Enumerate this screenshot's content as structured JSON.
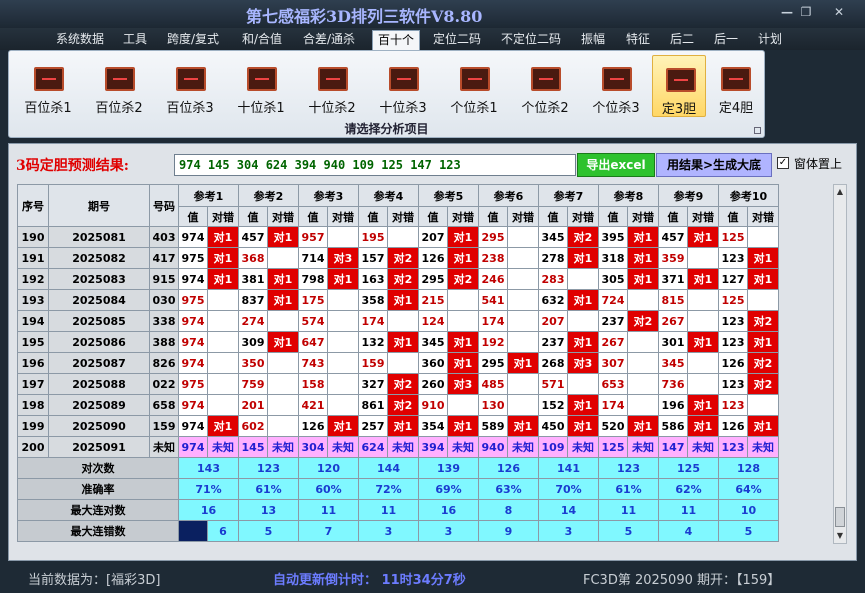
{
  "window": {
    "title": "第七感福彩3D排列三软件V8.80",
    "btn_min": "—",
    "btn_restore": "❐",
    "btn_close": "✕"
  },
  "menu": [
    "系统数据",
    "工具",
    "跨度/复式",
    "和/合值",
    "合差/通杀",
    "百十个",
    "定位二码",
    "不定位二码",
    "振幅",
    "特征",
    "后二",
    "后一",
    "计划"
  ],
  "menu_active": 5,
  "ribbon": {
    "buttons": [
      "百位杀1",
      "百位杀2",
      "百位杀3",
      "十位杀1",
      "十位杀2",
      "十位杀3",
      "个位杀1",
      "个位杀2",
      "个位杀3",
      "定3胆",
      "定4胆"
    ],
    "selected": 9,
    "label": "请选择分析项目"
  },
  "result": {
    "label": "3码定胆预测结果:",
    "value": "974 145 304 624 394 940 109 125 147 123",
    "export_label": "导出excel",
    "apply_label": "用结果>生成大底",
    "ontop_label": "窗体置上",
    "ontop_checked": "✓"
  },
  "table": {
    "headers": {
      "seq": "序号",
      "period": "期号",
      "num": "号码",
      "refs": [
        "参考1",
        "参考2",
        "参考3",
        "参考4",
        "参考5",
        "参考6",
        "参考7",
        "参考8",
        "参考9",
        "参考10"
      ],
      "val": "值",
      "ok": "对错"
    },
    "rows": [
      {
        "seq": "190",
        "period": "2025081",
        "num": "403",
        "cells": [
          [
            "974",
            "对1"
          ],
          [
            "457",
            "对1"
          ],
          [
            "957",
            ""
          ],
          [
            "195",
            ""
          ],
          [
            "207",
            "对1"
          ],
          [
            "295",
            ""
          ],
          [
            "345",
            "对2"
          ],
          [
            "395",
            "对1"
          ],
          [
            "457",
            "对1"
          ],
          [
            "125",
            ""
          ]
        ]
      },
      {
        "seq": "191",
        "period": "2025082",
        "num": "417",
        "cells": [
          [
            "975",
            "对1"
          ],
          [
            "368",
            ""
          ],
          [
            "714",
            "对3"
          ],
          [
            "157",
            "对2"
          ],
          [
            "126",
            "对1"
          ],
          [
            "238",
            ""
          ],
          [
            "278",
            "对1"
          ],
          [
            "318",
            "对1"
          ],
          [
            "359",
            ""
          ],
          [
            "123",
            "对1"
          ]
        ]
      },
      {
        "seq": "192",
        "period": "2025083",
        "num": "915",
        "cells": [
          [
            "974",
            "对1"
          ],
          [
            "381",
            "对1"
          ],
          [
            "798",
            "对1"
          ],
          [
            "163",
            "对2"
          ],
          [
            "295",
            "对2"
          ],
          [
            "246",
            ""
          ],
          [
            "283",
            ""
          ],
          [
            "305",
            "对1"
          ],
          [
            "371",
            "对1"
          ],
          [
            "127",
            "对1"
          ]
        ]
      },
      {
        "seq": "193",
        "period": "2025084",
        "num": "030",
        "cells": [
          [
            "975",
            ""
          ],
          [
            "837",
            "对1"
          ],
          [
            "175",
            ""
          ],
          [
            "358",
            "对1"
          ],
          [
            "215",
            ""
          ],
          [
            "541",
            ""
          ],
          [
            "632",
            "对1"
          ],
          [
            "724",
            ""
          ],
          [
            "815",
            ""
          ],
          [
            "125",
            ""
          ]
        ]
      },
      {
        "seq": "194",
        "period": "2025085",
        "num": "338",
        "cells": [
          [
            "974",
            ""
          ],
          [
            "274",
            ""
          ],
          [
            "574",
            ""
          ],
          [
            "174",
            ""
          ],
          [
            "124",
            ""
          ],
          [
            "174",
            ""
          ],
          [
            "207",
            ""
          ],
          [
            "237",
            "对2"
          ],
          [
            "267",
            ""
          ],
          [
            "123",
            "对2"
          ]
        ]
      },
      {
        "seq": "195",
        "period": "2025086",
        "num": "388",
        "cells": [
          [
            "974",
            ""
          ],
          [
            "309",
            "对1"
          ],
          [
            "647",
            ""
          ],
          [
            "132",
            "对1"
          ],
          [
            "345",
            "对1"
          ],
          [
            "192",
            ""
          ],
          [
            "237",
            "对1"
          ],
          [
            "267",
            ""
          ],
          [
            "301",
            "对1"
          ],
          [
            "123",
            "对1"
          ]
        ]
      },
      {
        "seq": "196",
        "period": "2025087",
        "num": "826",
        "cells": [
          [
            "974",
            ""
          ],
          [
            "350",
            ""
          ],
          [
            "743",
            ""
          ],
          [
            "159",
            ""
          ],
          [
            "360",
            "对1"
          ],
          [
            "295",
            "对1"
          ],
          [
            "268",
            "对3"
          ],
          [
            "307",
            ""
          ],
          [
            "345",
            ""
          ],
          [
            "126",
            "对2"
          ]
        ]
      },
      {
        "seq": "197",
        "period": "2025088",
        "num": "022",
        "cells": [
          [
            "975",
            ""
          ],
          [
            "759",
            ""
          ],
          [
            "158",
            ""
          ],
          [
            "327",
            "对2"
          ],
          [
            "260",
            "对3"
          ],
          [
            "485",
            ""
          ],
          [
            "571",
            ""
          ],
          [
            "653",
            ""
          ],
          [
            "736",
            ""
          ],
          [
            "123",
            "对2"
          ]
        ]
      },
      {
        "seq": "198",
        "period": "2025089",
        "num": "658",
        "cells": [
          [
            "974",
            ""
          ],
          [
            "201",
            ""
          ],
          [
            "421",
            ""
          ],
          [
            "861",
            "对2"
          ],
          [
            "910",
            ""
          ],
          [
            "130",
            ""
          ],
          [
            "152",
            "对1"
          ],
          [
            "174",
            ""
          ],
          [
            "196",
            "对1"
          ],
          [
            "123",
            ""
          ]
        ]
      },
      {
        "seq": "199",
        "period": "2025090",
        "num": "159",
        "cells": [
          [
            "974",
            "对1"
          ],
          [
            "602",
            ""
          ],
          [
            "126",
            "对1"
          ],
          [
            "257",
            "对1"
          ],
          [
            "354",
            "对1"
          ],
          [
            "589",
            "对1"
          ],
          [
            "450",
            "对1"
          ],
          [
            "520",
            "对1"
          ],
          [
            "586",
            "对1"
          ],
          [
            "126",
            "对1"
          ]
        ]
      }
    ],
    "pred": {
      "seq": "200",
      "period": "2025091",
      "num": "未知",
      "vals": [
        "974",
        "145",
        "304",
        "624",
        "394",
        "940",
        "109",
        "125",
        "147",
        "123"
      ],
      "unk": "未知"
    },
    "stats": [
      {
        "label": "对次数",
        "vals": [
          "143",
          "123",
          "120",
          "144",
          "139",
          "126",
          "141",
          "123",
          "125",
          "128"
        ]
      },
      {
        "label": "准确率",
        "vals": [
          "71%",
          "61%",
          "60%",
          "72%",
          "69%",
          "63%",
          "70%",
          "61%",
          "62%",
          "64%"
        ]
      },
      {
        "label": "最大连对数",
        "vals": [
          "16",
          "13",
          "11",
          "11",
          "16",
          "8",
          "14",
          "11",
          "11",
          "10"
        ]
      },
      {
        "label": "最大连错数",
        "vals": [
          "6",
          "5",
          "7",
          "3",
          "3",
          "9",
          "3",
          "5",
          "4",
          "5"
        ]
      }
    ]
  },
  "status": {
    "current": "当前数据为：[福彩3D]",
    "countdown": "自动更新倒计时： 11时34分7秒",
    "issue": "FC3D第 2025090 期开：【159】"
  },
  "colors": {
    "hit": "#e00000",
    "pred": "#ffb0ff",
    "stats": "#80f8ff",
    "result_text": "#006400"
  }
}
